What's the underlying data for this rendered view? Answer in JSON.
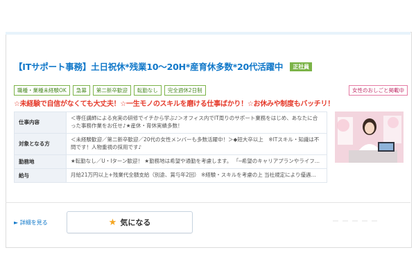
{
  "job": {
    "title": "【ITサポート事務】土日祝休*残業10～20H*産育休多数*20代活躍中",
    "employment_badge": "正社員",
    "tags": [
      "職種・業種未経験OK",
      "急募",
      "第二新卒歓迎",
      "転勤なし",
      "完全週休2日制"
    ],
    "feature_tag": "女性のおしごと掲載中",
    "catchphrase": "☆未経験で自信がなくても大丈夫！☆一生モノのスキルを磨ける仕事ばかり！☆お休みや制度もバッチリ！",
    "info_rows": [
      {
        "label": "仕事内容",
        "value": "＜専任講師による充実の研修でイチから学ぶ♪＞オフィス内でIT周りのサポート業務をはじめ、あなたに合った事務作業をお任せ♪★産休・育休実績多数！"
      },
      {
        "label": "対象となる方",
        "value": "＜未経験歓迎／第二新卒歓迎／20代の女性メンバーも多数活躍中！＞◆短大卒以上　※ITスキル・知識は不問です！人物重視の採用です♪"
      },
      {
        "label": "勤務地",
        "value": "★転勤なし／U・Iターン歓迎！ ★勤務地は希望や通勤を考慮します。 「─希望のキャリアプランやライフ..."
      },
      {
        "label": "給与",
        "value": "月給21万円以上+残業代全額支給（別途、賞与年2回） ※経験・スキルを考慮の上 当社規定により優遇..."
      }
    ]
  },
  "actions": {
    "detail_link": "► 詳細を見る",
    "favorite_label": "気になる"
  },
  "colors": {
    "title": "#1178c9",
    "catchphrase": "#e53b2c",
    "tag_green": "#7bb347",
    "tag_pink": "#e57aa3",
    "star": "#f4a623"
  }
}
